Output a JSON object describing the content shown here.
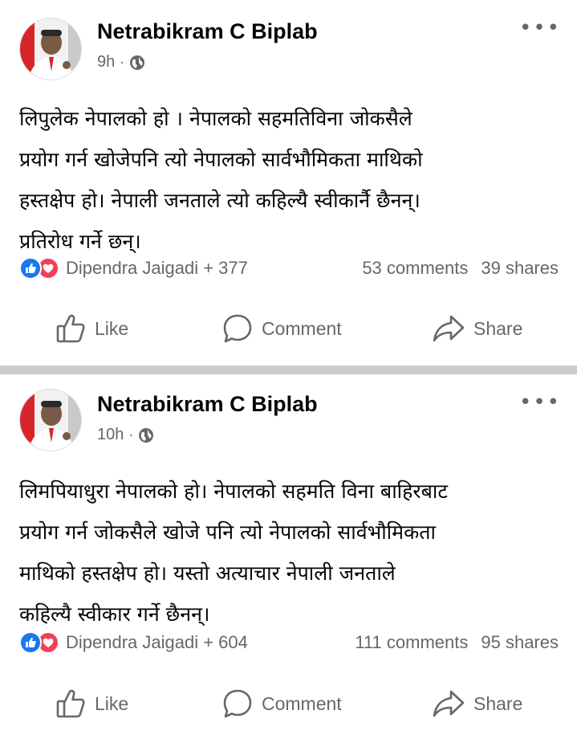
{
  "posts": [
    {
      "author": "Netrabikram C Biplab",
      "time": "9h",
      "separator": "·",
      "more": "•••",
      "body_lines": [
        "लिपुलेक नेपालको हो । नेपालको सहमतिविना जोकसैले",
        "प्रयोग गर्न खोजेपनि त्यो नेपालको सार्वभौमिकता माथिको",
        "हस्तक्षेप हो। नेपाली जनताले त्यो कहिल्यै स्वीकार्नै छैनन्।",
        "प्रतिरोध गर्ने छन्।"
      ],
      "reactions_text": "Dipendra Jaigadi + 377",
      "comments": "53 comments",
      "shares": "39 shares",
      "actions": {
        "like": "Like",
        "comment": "Comment",
        "share": "Share"
      }
    },
    {
      "author": "Netrabikram C Biplab",
      "time": "10h",
      "separator": "·",
      "more": "•••",
      "body_lines": [
        "लिमपियाधुरा नेपालको हो। नेपालको सहमति विना बाहिरबाट",
        "प्रयोग गर्न जोकसैले खोजे पनि त्यो नेपालको  सार्वभौमिकता",
        "माथिको हस्तक्षेप हो। यस्तो अत्याचार नेपाली जनताले",
        "कहिल्यै स्वीकार गर्ने छैनन्।"
      ],
      "reactions_text": "Dipendra Jaigadi + 604",
      "comments": "111 comments",
      "shares": "95 shares",
      "actions": {
        "like": "Like",
        "comment": "Comment",
        "share": "Share"
      }
    }
  ],
  "icons": {
    "globe": "globe-icon",
    "more": "more-options-icon",
    "like_reaction": "like-reaction-icon",
    "love_reaction": "love-reaction-icon",
    "like_action": "thumbs-up-icon",
    "comment_action": "speech-bubble-icon",
    "share_action": "share-arrow-icon"
  },
  "colors": {
    "text_primary": "#050505",
    "text_secondary": "#65676b",
    "like_blue": "#1877f2",
    "love_red": "#f33e58",
    "separator": "#c9ccd1"
  }
}
